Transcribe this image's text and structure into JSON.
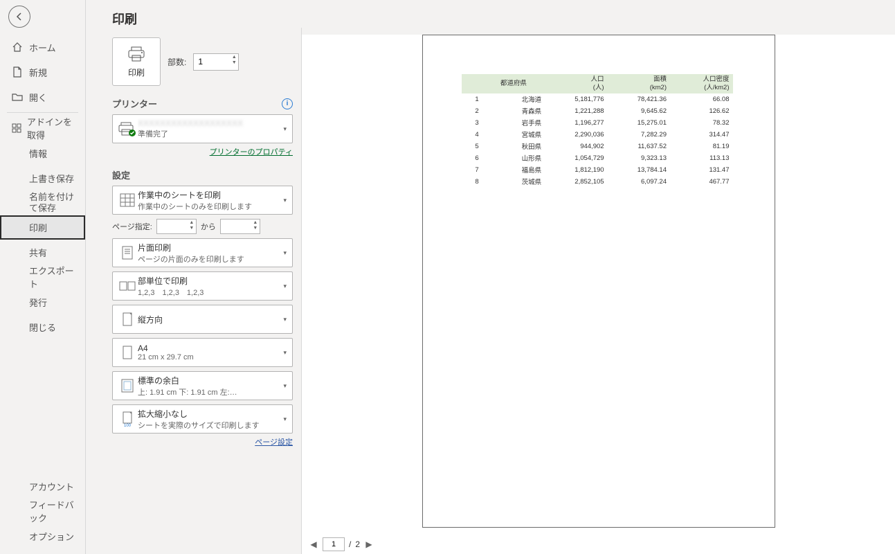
{
  "page_title": "印刷",
  "sidebar": {
    "home": "ホーム",
    "new": "新規",
    "open": "開く",
    "addin": "アドインを取得",
    "info": "情報",
    "save": "上書き保存",
    "saveas": "名前を付けて保存",
    "print": "印刷",
    "share": "共有",
    "export": "エクスポート",
    "publish": "発行",
    "close": "閉じる",
    "account": "アカウント",
    "feedback": "フィードバック",
    "options": "オプション"
  },
  "print": {
    "button_label": "印刷",
    "copies_label": "部数:",
    "copies_value": "1"
  },
  "printer": {
    "section_label": "プリンター",
    "status": "準備完了",
    "properties_link": "プリンターのプロパティ"
  },
  "settings": {
    "section_label": "設定",
    "what": {
      "l1": "作業中のシートを印刷",
      "l2": "作業中のシートのみを印刷します"
    },
    "pages_label": "ページ指定:",
    "pages_to": "から",
    "sides": {
      "l1": "片面印刷",
      "l2": "ページの片面のみを印刷します"
    },
    "collate": {
      "l1": "部単位で印刷",
      "l2": "1,2,3　1,2,3　1,2,3"
    },
    "orient": {
      "l1": "縦方向",
      "l2": ""
    },
    "paper": {
      "l1": "A4",
      "l2": "21 cm x 29.7 cm"
    },
    "margins": {
      "l1": "標準の余白",
      "l2": "上: 1.91 cm 下: 1.91 cm 左:…"
    },
    "scaling": {
      "l1": "拡大縮小なし",
      "l2": "シートを実際のサイズで印刷します"
    },
    "page_setup_link": "ページ設定"
  },
  "preview": {
    "pager_current": "1",
    "pager_total": "2",
    "pager_sep": "/",
    "headers": {
      "pref": "都道府県",
      "pop1": "人口",
      "pop2": "(人)",
      "area1": "面積",
      "area2": "(km2)",
      "dens1": "人口密度",
      "dens2": "(人/km2)"
    },
    "rows": [
      {
        "n": "1",
        "pref": "北海道",
        "pop": "5,181,776",
        "area": "78,421.36",
        "dens": "66.08"
      },
      {
        "n": "2",
        "pref": "青森県",
        "pop": "1,221,288",
        "area": "9,645.62",
        "dens": "126.62"
      },
      {
        "n": "3",
        "pref": "岩手県",
        "pop": "1,196,277",
        "area": "15,275.01",
        "dens": "78.32"
      },
      {
        "n": "4",
        "pref": "宮城県",
        "pop": "2,290,036",
        "area": "7,282.29",
        "dens": "314.47"
      },
      {
        "n": "5",
        "pref": "秋田県",
        "pop": "944,902",
        "area": "11,637.52",
        "dens": "81.19"
      },
      {
        "n": "6",
        "pref": "山形県",
        "pop": "1,054,729",
        "area": "9,323.13",
        "dens": "113.13"
      },
      {
        "n": "7",
        "pref": "福島県",
        "pop": "1,812,190",
        "area": "13,784.14",
        "dens": "131.47"
      },
      {
        "n": "8",
        "pref": "茨城県",
        "pop": "2,852,105",
        "area": "6,097.24",
        "dens": "467.77"
      }
    ]
  }
}
